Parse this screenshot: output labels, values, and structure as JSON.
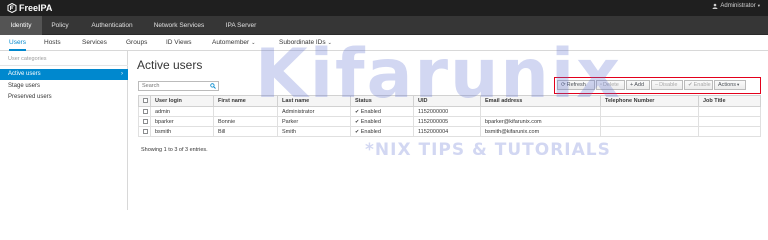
{
  "brand": {
    "name": "FreeIPA"
  },
  "user_menu": {
    "label": "Administrator"
  },
  "nav": {
    "tabs": [
      {
        "label": "Identity"
      },
      {
        "label": "Policy"
      },
      {
        "label": "Authentication"
      },
      {
        "label": "Network Services"
      },
      {
        "label": "IPA Server"
      }
    ]
  },
  "subnav": {
    "tabs": [
      {
        "label": "Users"
      },
      {
        "label": "Hosts"
      },
      {
        "label": "Services"
      },
      {
        "label": "Groups"
      },
      {
        "label": "ID Views"
      },
      {
        "label": "Automember"
      },
      {
        "label": "Subordinate IDs"
      }
    ]
  },
  "sidebar": {
    "category": "User categories",
    "items": [
      {
        "label": "Active users"
      },
      {
        "label": "Stage users"
      },
      {
        "label": "Preserved users"
      }
    ]
  },
  "main": {
    "title": "Active users",
    "search": {
      "placeholder": "Search"
    },
    "toolbar": {
      "refresh": "Refresh",
      "delete": "Delete",
      "add": "Add",
      "disable": "Disable",
      "enable": "Enable",
      "actions": "Actions"
    },
    "table": {
      "columns": [
        "User login",
        "First name",
        "Last name",
        "Status",
        "UID",
        "Email address",
        "Telephone Number",
        "Job Title"
      ],
      "rows": [
        {
          "login": "admin",
          "first": "",
          "last": "Administrator",
          "status": "Enabled",
          "uid": "1152000000",
          "email": "",
          "phone": "",
          "job": ""
        },
        {
          "login": "bparker",
          "first": "Bonnie",
          "last": "Parker",
          "status": "Enabled",
          "uid": "1152000005",
          "email": "bparker@kifarunix.com",
          "phone": "",
          "job": ""
        },
        {
          "login": "bsmith",
          "first": "Bill",
          "last": "Smith",
          "status": "Enabled",
          "uid": "1152000004",
          "email": "bsmith@kifarunix.com",
          "phone": "",
          "job": ""
        }
      ]
    },
    "summary": "Showing 1 to 3 of 3 entries."
  },
  "watermark": {
    "text": "Kifarunix",
    "tagline": "*NIX TIPS & TUTORIALS"
  },
  "colors": {
    "accent": "#0088ce",
    "highlight_border": "#e3001b",
    "topbar": "#1f1f1f",
    "navbar": "#363636"
  }
}
